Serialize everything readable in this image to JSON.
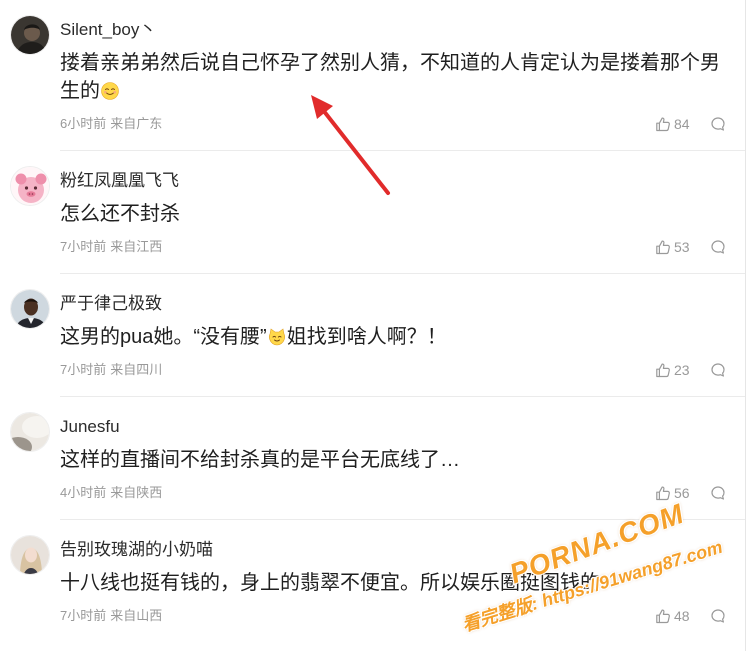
{
  "comments": [
    {
      "username": "Silent_boy丶",
      "text_before": "搂着亲弟弟然后说自己怀孕了然别人猜，不知道的人肯定认为是搂着那个男生的",
      "emoji": "smiling-face-emoji",
      "time": "6小时前",
      "location": "来自广东",
      "likes": "84"
    },
    {
      "username": "粉红凤凰凰飞飞",
      "text": "怎么还不封杀",
      "time": "7小时前",
      "location": "来自江西",
      "likes": "53"
    },
    {
      "username": "严于律己极致",
      "text_before": "这男的pua她。“没有腰”",
      "emoji": "cat-face-emoji",
      "text_after": "姐找到啥人啊？！",
      "time": "7小时前",
      "location": "来自四川",
      "likes": "23"
    },
    {
      "username": "Junesfu",
      "text": "这样的直播间不给封杀真的是平台无底线了…",
      "time": "4小时前",
      "location": "来自陕西",
      "likes": "56"
    },
    {
      "username": "告别玫瑰湖的小奶喵",
      "text": "十八线也挺有钱的，身上的翡翠不便宜。所以娱乐圈挺图钱的",
      "time": "7小时前",
      "location": "来自山西",
      "likes": "48"
    }
  ],
  "icons": {
    "like": "thumb-up-icon",
    "comment": "comment-bubble-icon"
  },
  "watermark": {
    "brand": "PORNA.COM",
    "promo": "看完整版: https://91wang87.com"
  },
  "colors": {
    "annotation_arrow": "#e12b2b",
    "watermark": "#f5a02a",
    "meta_text": "#999999",
    "body_text": "#1f1f1f",
    "divider": "#ebebeb"
  }
}
